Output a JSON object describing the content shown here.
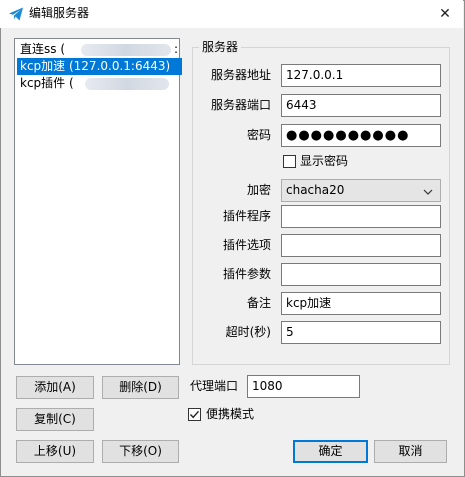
{
  "window": {
    "title": "编辑服务器",
    "close_symbol": "✕"
  },
  "server_list": {
    "items": [
      {
        "label": "直连ss (",
        "suffix": ":",
        "selected": false
      },
      {
        "label": "kcp加速 (127.0.0.1:6443)",
        "suffix": "",
        "selected": true
      },
      {
        "label": "kcp插件 (",
        "suffix": "",
        "selected": false
      }
    ]
  },
  "server_group": {
    "title": "服务器",
    "fields": {
      "address": {
        "label": "服务器地址",
        "value": "127.0.0.1"
      },
      "port": {
        "label": "服务器端口",
        "value": "6443"
      },
      "password": {
        "label": "密码",
        "value": "●●●●●●●●●●"
      },
      "show_password": {
        "label": "显示密码",
        "checked": false
      },
      "encryption": {
        "label": "加密",
        "value": "chacha20"
      },
      "plugin_program": {
        "label": "插件程序",
        "value": ""
      },
      "plugin_options": {
        "label": "插件选项",
        "value": ""
      },
      "plugin_args": {
        "label": "插件参数",
        "value": ""
      },
      "remark": {
        "label": "备注",
        "value": "kcp加速"
      },
      "timeout": {
        "label": "超时(秒)",
        "value": "5"
      }
    }
  },
  "proxy_port": {
    "label": "代理端口",
    "value": "1080"
  },
  "portable_mode": {
    "label": "便携模式",
    "checked": true
  },
  "buttons": {
    "add": "添加(A)",
    "delete": "删除(D)",
    "copy": "复制(C)",
    "move_up": "上移(U)",
    "move_down": "下移(O)",
    "ok": "确定",
    "cancel": "取消"
  },
  "colors": {
    "selection": "#0078d7",
    "title_icon": "#1a8ad4"
  }
}
